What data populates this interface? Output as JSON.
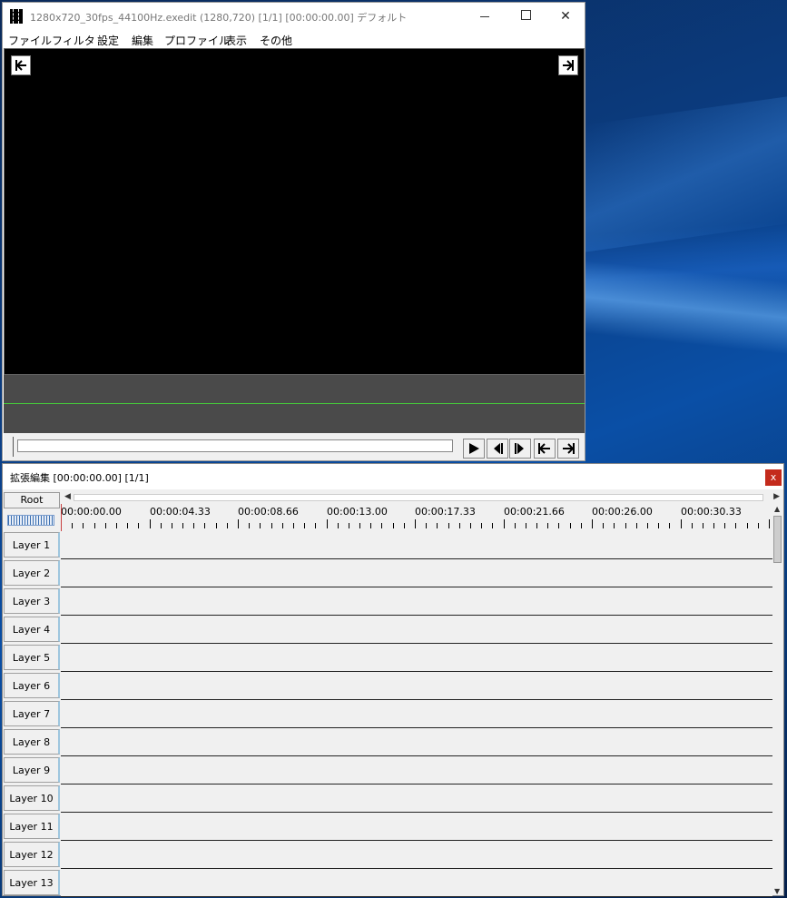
{
  "main_window": {
    "title": "1280x720_30fps_44100Hz.exedit (1280,720)  [1/1] [00:00:00.00]  デフォルト",
    "menu": [
      "ファイル",
      "フィルタ",
      "設定",
      "編集",
      "プロファイル",
      "表示",
      "その他"
    ]
  },
  "timeline_window": {
    "title": "拡張編集 [00:00:00.00] [1/1]",
    "close_label": "x",
    "root_label": "Root",
    "ruler_labels": [
      "00:00:00.00",
      "00:00:04.33",
      "00:00:08.66",
      "00:00:13.00",
      "00:00:17.33",
      "00:00:21.66",
      "00:00:26.00",
      "00:00:30.33"
    ],
    "layers": [
      "Layer  1",
      "Layer  2",
      "Layer  3",
      "Layer  4",
      "Layer  5",
      "Layer  6",
      "Layer  7",
      "Layer  8",
      "Layer  9",
      "Layer 10",
      "Layer 11",
      "Layer 12",
      "Layer 13"
    ]
  },
  "colors": {
    "preview_bg": "#000000",
    "panel_gray": "#4a4a4a",
    "audio_line": "#46d03a",
    "close_red": "#c42b1c"
  }
}
